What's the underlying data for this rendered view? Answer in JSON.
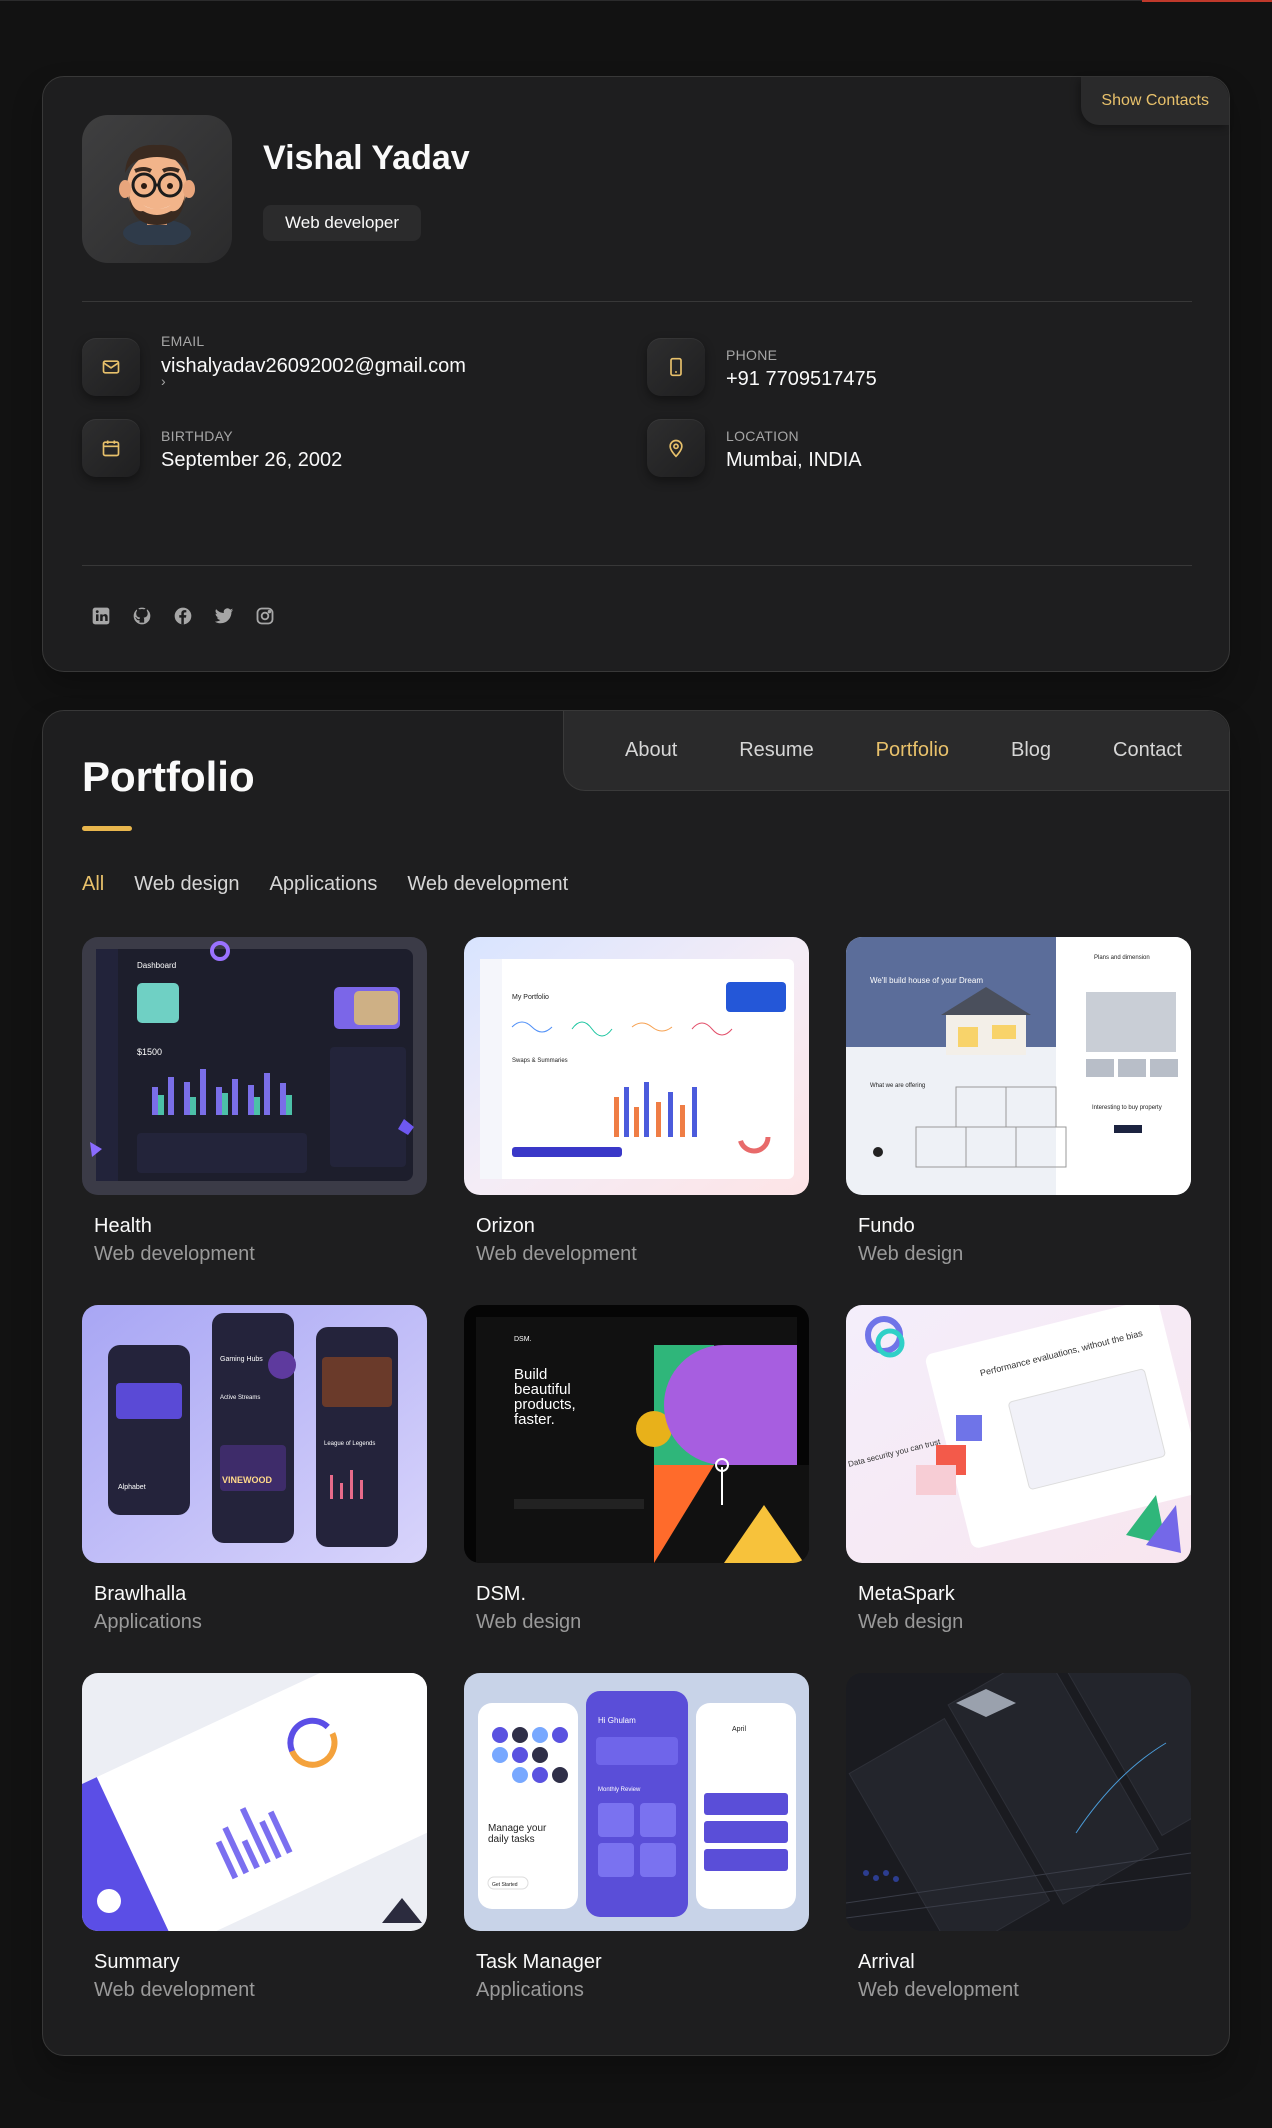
{
  "profile": {
    "name": "Vishal Yadav",
    "title": "Web developer",
    "show_contacts_label": "Show Contacts",
    "contacts": {
      "email": {
        "label": "EMAIL",
        "value": "vishalyadav26092002@gmail.com"
      },
      "phone": {
        "label": "PHONE",
        "value": "+91 7709517475"
      },
      "birthday": {
        "label": "BIRTHDAY",
        "value": "September 26, 2002"
      },
      "location": {
        "label": "LOCATION",
        "value": "Mumbai, INDIA"
      }
    },
    "social_icons": [
      "linkedin-icon",
      "github-icon",
      "facebook-icon",
      "twitter-icon",
      "instagram-icon"
    ]
  },
  "nav": {
    "items": [
      "About",
      "Resume",
      "Portfolio",
      "Blog",
      "Contact"
    ],
    "active": "Portfolio"
  },
  "portfolio": {
    "title": "Portfolio",
    "filters": [
      "All",
      "Web design",
      "Applications",
      "Web development"
    ],
    "active_filter": "All",
    "projects": [
      {
        "title": "Health",
        "category": "Web development"
      },
      {
        "title": "Orizon",
        "category": "Web development"
      },
      {
        "title": "Fundo",
        "category": "Web design"
      },
      {
        "title": "Brawlhalla",
        "category": "Applications"
      },
      {
        "title": "DSM.",
        "category": "Web design"
      },
      {
        "title": "MetaSpark",
        "category": "Web design"
      },
      {
        "title": "Summary",
        "category": "Web development"
      },
      {
        "title": "Task Manager",
        "category": "Applications"
      },
      {
        "title": "Arrival",
        "category": "Web development"
      }
    ],
    "thumb_text": {
      "health": {
        "heading": "Dashboard",
        "amount": "$1500"
      },
      "orizon": {
        "heading": "My Portfolio",
        "sub": "Swaps & Summaries"
      },
      "fundo": {
        "hero": "We'll build house of your Dream",
        "side": "Plans and dimension",
        "offer": "What we are offering",
        "buy": "Interesting to buy property"
      },
      "brawl": {
        "t1": "Gaming Hubs",
        "t2": "Active Streams",
        "t3": "Alphabet",
        "t4": "League of Legends",
        "t5": "VINEWOOD"
      },
      "dsm": {
        "logo": "DSM.",
        "headline": "Build beautiful products, faster."
      },
      "meta": {
        "t1": "Performance evaluations, without the bias",
        "t2": "Data security you can trust"
      },
      "task": {
        "greet": "Hi Ghulam",
        "manage": "Manage your daily tasks",
        "month": "April",
        "review": "Monthly Review",
        "start": "Get Started"
      }
    }
  },
  "colors": {
    "accent": "#e8c16b",
    "background": "#121212",
    "card": "#1e1e1f"
  }
}
